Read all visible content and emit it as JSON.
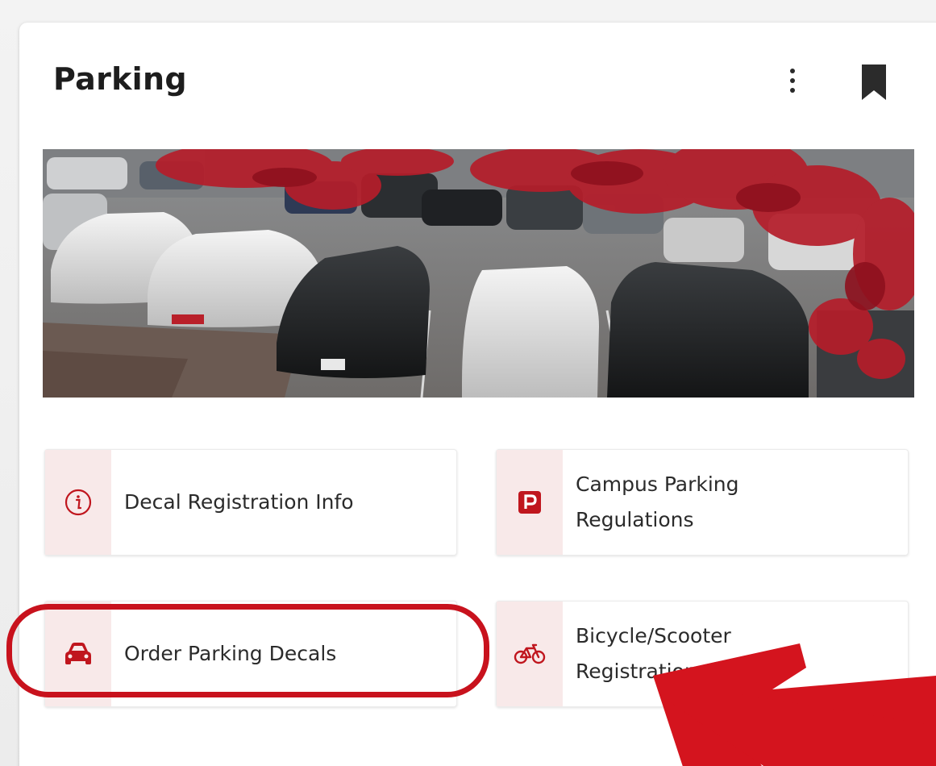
{
  "card": {
    "title": "Parking",
    "menu_icon": "more-vertical-icon",
    "bookmark_icon": "bookmark-icon"
  },
  "banner": {
    "image": "parking-lot-photo"
  },
  "tiles": [
    {
      "label_line1": "Decal Registration Info",
      "label_line2": "",
      "icon": "info-circle-icon"
    },
    {
      "label_line1": "Campus Parking",
      "label_line2": "Regulations",
      "icon": "parking-sign-icon"
    },
    {
      "label_line1": "Order Parking Decals",
      "label_line2": "",
      "icon": "car-icon"
    },
    {
      "label_line1": "Bicycle/Scooter",
      "label_line2": "Registration",
      "icon": "bicycle-icon"
    }
  ],
  "annotations": {
    "highlight": "red-circle-around-order-parking-decals",
    "arrow": "red-arrow-pointer"
  },
  "colors": {
    "accent": "#c0161e",
    "icon_strip": "#f8e9e9",
    "annotation": "#d4141e"
  }
}
